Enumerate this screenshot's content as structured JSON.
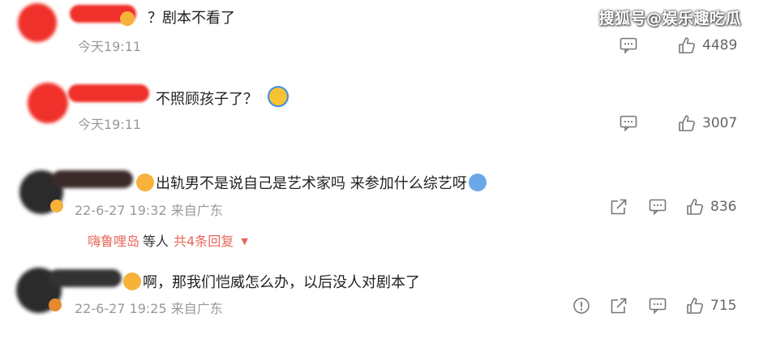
{
  "watermark": "搜狐号@娱乐趣吃瓜",
  "comments": [
    {
      "text": "？剧本不看了",
      "time": "今天19:11",
      "likes": "4489",
      "comment_icon": "comment-icon",
      "like_icon": "thumbs-up-icon"
    },
    {
      "text": "不照顾孩子了？",
      "time": "今天19:11",
      "likes": "3007",
      "comment_icon": "comment-icon",
      "like_icon": "thumbs-up-icon"
    },
    {
      "text": "出轨男不是说自己是艺术家吗 来参加什么综艺呀",
      "time": "22-6-27 19:32 来自广东",
      "likes": "836",
      "replies": {
        "names": "嗨鲁哩岛",
        "etc": "等人",
        "total": "共4条回复"
      }
    },
    {
      "text": "啊，那我们恺威怎么办，以后没人对剧本了",
      "time": "22-6-27 19:25 来自广东",
      "likes": "715"
    }
  ],
  "colors": {
    "redacted": "#f0302a",
    "redacted_dark": "#2b2b2b",
    "reply_link": "#e8675a",
    "muted": "#999999"
  }
}
